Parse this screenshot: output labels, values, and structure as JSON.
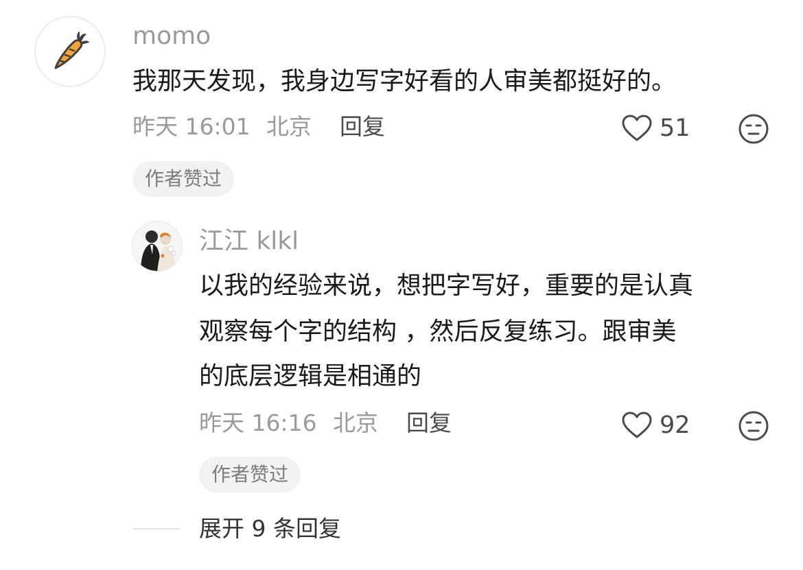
{
  "comment": {
    "username": "momo",
    "avatar_icon": "carrot-icon",
    "text": "我那天发现，我身边写字好看的人审美都挺好的。",
    "time": "昨天 16:01",
    "location": "北京",
    "reply_label": "回复",
    "like_count": "51",
    "badge": "作者赞过"
  },
  "reply": {
    "username": "江江 klkl",
    "avatar_icon": "couple-illustration-avatar",
    "text_lines": [
      "以我的经验来说，想把字写好，重要的是认真",
      "观察每个字的结构 ，然后反复练习。跟审美",
      "的底层逻辑是相通的"
    ],
    "time": "昨天 16:16",
    "location": "北京",
    "reply_label": "回复",
    "like_count": "92",
    "badge": "作者赞过"
  },
  "expand": {
    "label": "展开 9 条回复"
  },
  "colors": {
    "carrot": "#f2a33a",
    "muted": "#9a9a9a",
    "badge_bg": "#f2f2f2"
  }
}
